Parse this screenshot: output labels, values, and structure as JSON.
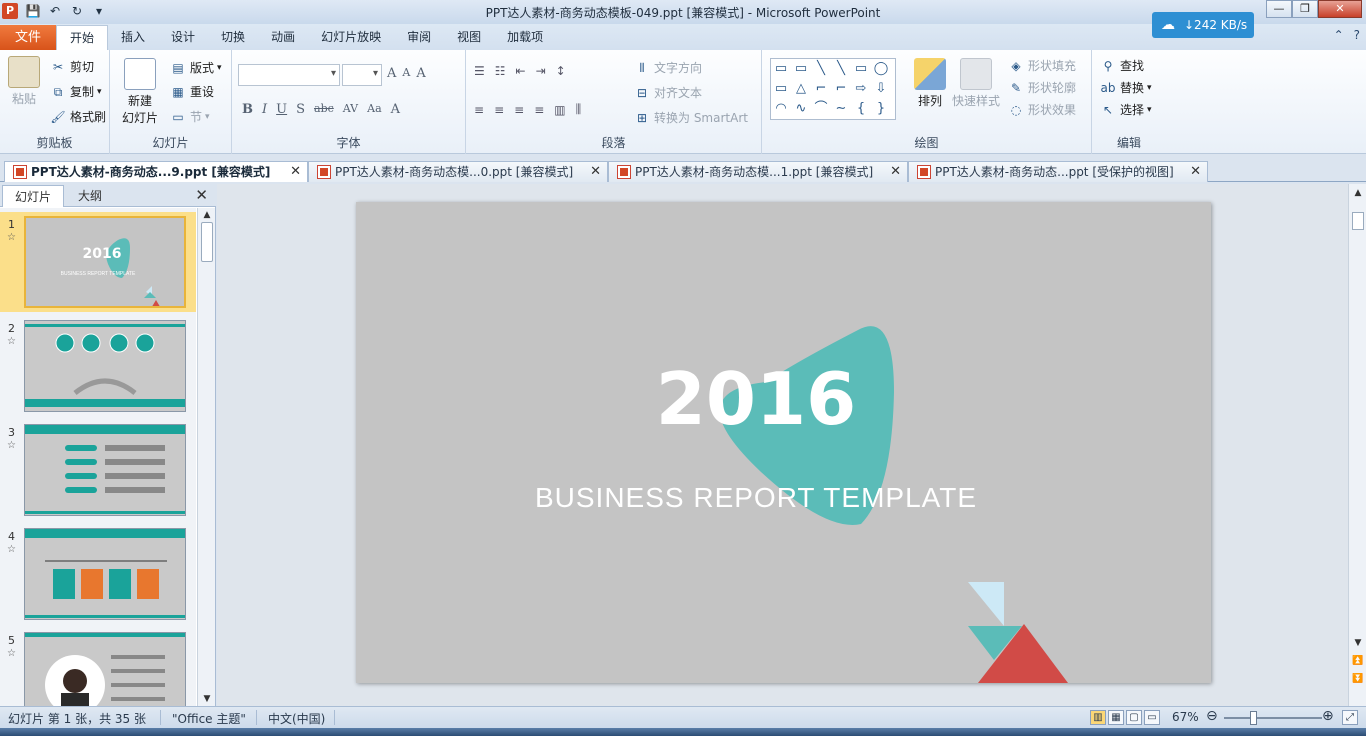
{
  "window": {
    "title": "PPT达人素材-商务动态模板-049.ppt [兼容模式] - Microsoft PowerPoint",
    "app_icon": "P",
    "net_speed": "↓242 KB/s",
    "controls": [
      "—",
      "❐",
      "✕"
    ]
  },
  "ribbon_tabs": {
    "file": "文件",
    "tabs": [
      "开始",
      "插入",
      "设计",
      "切换",
      "动画",
      "幻灯片放映",
      "审阅",
      "视图",
      "加载项"
    ],
    "active": "开始",
    "help": "?"
  },
  "clipboard": {
    "paste": "粘贴",
    "cut": "剪切",
    "copy": "复制",
    "format_painter": "格式刷",
    "group": "剪贴板"
  },
  "slides_group": {
    "new_slide": "新建",
    "new_slide_2": "幻灯片",
    "layout": "版式",
    "reset": "重设",
    "section": "节",
    "group": "幻灯片"
  },
  "font_group": {
    "grow": "A",
    "shrink": "A",
    "clear": "A",
    "bold": "B",
    "italic": "I",
    "underline": "U",
    "shadow": "S",
    "strike": "abc",
    "spacing": "AV",
    "case": "Aa",
    "color": "A",
    "group": "字体"
  },
  "paragraph_group": {
    "text_direction": "文字方向",
    "align_text": "对齐文本",
    "smartart": "转换为 SmartArt",
    "group": "段落"
  },
  "drawing_group": {
    "shapes": [
      "▭",
      "▭",
      "╲",
      "╲",
      "▭",
      "◯",
      "▭",
      "△",
      "⌐",
      "⌐",
      "⇨",
      "⇩",
      "◠",
      "∿",
      "⌒",
      "∼",
      "{",
      "}"
    ],
    "arrange": "排列",
    "quick_styles": "快速样式",
    "fill": "形状填充",
    "outline": "形状轮廓",
    "effects": "形状效果",
    "group": "绘图"
  },
  "editing_group": {
    "find": "查找",
    "replace": "替换",
    "select": "选择",
    "group": "编辑"
  },
  "doc_tabs": [
    {
      "label": "PPT达人素材-商务动态...9.ppt [兼容模式]",
      "active": true
    },
    {
      "label": "PPT达人素材-商务动态模...0.ppt [兼容模式]",
      "active": false
    },
    {
      "label": "PPT达人素材-商务动态模...1.ppt [兼容模式]",
      "active": false
    },
    {
      "label": "PPT达人素材-商务动态...ppt [受保护的视图]",
      "active": false
    }
  ],
  "left_pane": {
    "tabs": [
      "幻灯片",
      "大纲"
    ],
    "thumbnails": [
      {
        "num": "1",
        "star": "☆",
        "title": "2016",
        "subtitle": "BUSINESS REPORT TEMPLATE"
      },
      {
        "num": "2",
        "star": "☆"
      },
      {
        "num": "3",
        "star": "☆"
      },
      {
        "num": "4",
        "star": "☆"
      },
      {
        "num": "5",
        "star": "☆"
      }
    ]
  },
  "slide": {
    "year": "2016",
    "subtitle": "BUSINESS  REPORT  TEMPLATE",
    "colors": {
      "bg": "#c4c4c4",
      "teal": "#5bbcb8",
      "red": "#d14b47",
      "lightblue": "#cde9f6"
    }
  },
  "status": {
    "slide_info": "幻灯片 第 1 张，共 35 张",
    "theme": "\"Office 主题\"",
    "language": "中文(中国)",
    "zoom": "67%"
  }
}
